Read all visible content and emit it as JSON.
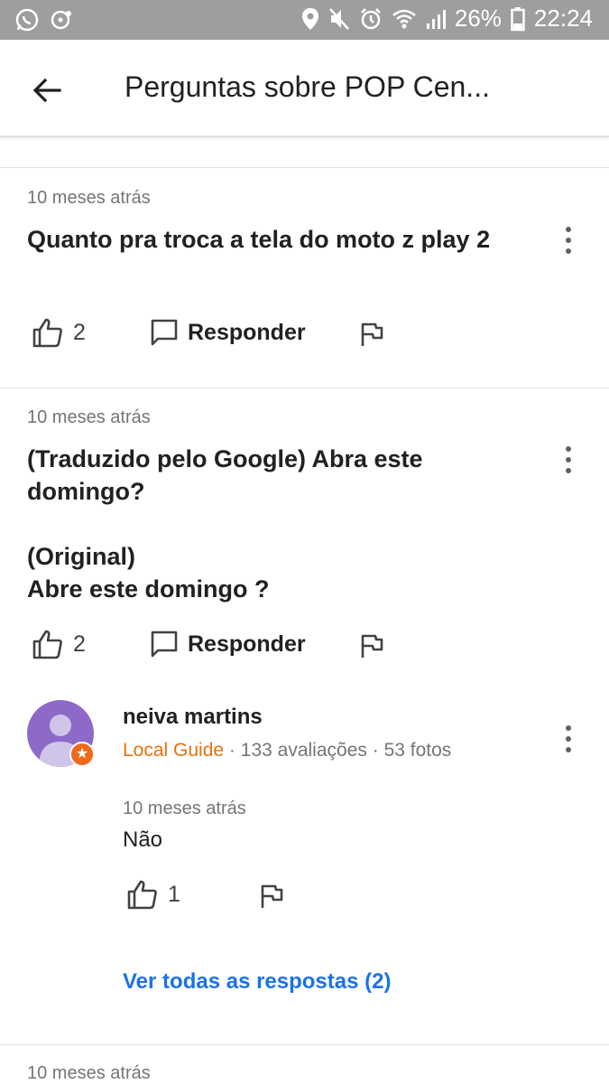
{
  "status_bar": {
    "left_icons": [
      "whatsapp-icon",
      "notification-icon"
    ],
    "battery": "26%",
    "time": "22:24",
    "right_icons": [
      "location-icon",
      "mute-icon",
      "alarm-icon",
      "wifi-icon",
      "signal-icon",
      "battery-icon"
    ]
  },
  "app_bar": {
    "title": "Perguntas sobre POP Cen..."
  },
  "questions": [
    {
      "timestamp": "10 meses atrás",
      "text": "Quanto pra troca a tela do moto z play 2",
      "likes": "2",
      "reply_label": "Responder"
    },
    {
      "timestamp": "10 meses atrás",
      "text": "(Traduzido pelo Google) Abra este\ndomingo?\n\n(Original)\nAbre este domingo ?",
      "likes": "2",
      "reply_label": "Responder",
      "answer": {
        "author": "neiva martins",
        "badge": "Local Guide",
        "reviews": "133 avaliações",
        "photos": "53 fotos",
        "separator": "·",
        "timestamp": "10 meses atrás",
        "text": "Não",
        "likes": "1"
      },
      "see_all": "Ver todas as respostas (2)"
    },
    {
      "timestamp": "10 meses atrás"
    }
  ],
  "colors": {
    "status_bar_bg": "#9e9e9e",
    "link": "#1a73e8",
    "local_guide": "#e8710a",
    "avatar_bg": "#8e6ac8"
  }
}
